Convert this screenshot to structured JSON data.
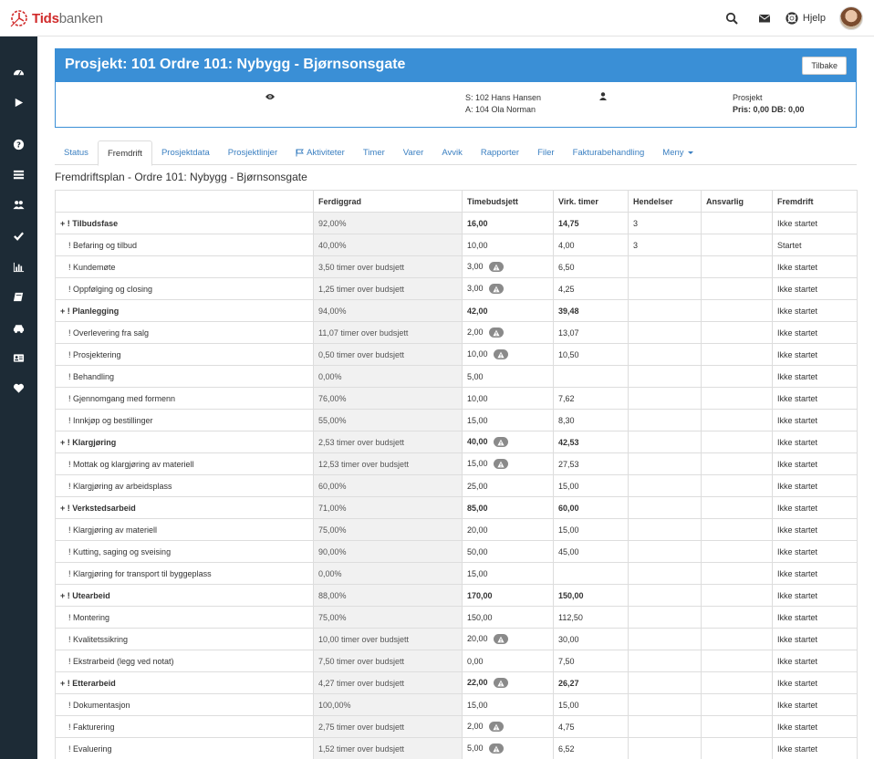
{
  "brand": {
    "part1": "Tids",
    "part2": "banken"
  },
  "topbar": {
    "help_label": "Hjelp"
  },
  "panel": {
    "title": "Prosjekt: 101 Ordre 101: Nybygg - Bjørnsonsgate",
    "back_label": "Tilbake",
    "line_s": "S: 102 Hans Hansen",
    "line_a": "A: 104 Ola Norman",
    "type_label": "Prosjekt",
    "price_label": "Pris: 0,00 DB: 0,00"
  },
  "tabs": [
    {
      "label": "Status"
    },
    {
      "label": "Fremdrift"
    },
    {
      "label": "Prosjektdata"
    },
    {
      "label": "Prosjektlinjer"
    },
    {
      "label": "Aktiviteter"
    },
    {
      "label": "Timer"
    },
    {
      "label": "Varer"
    },
    {
      "label": "Avvik"
    },
    {
      "label": "Rapporter"
    },
    {
      "label": "Filer"
    },
    {
      "label": "Fakturabehandling"
    },
    {
      "label": "Meny"
    }
  ],
  "section_title": "Fremdriftsplan - Ordre 101: Nybygg - Bjørnsonsgate",
  "table": {
    "headers": [
      "",
      "Ferdiggrad",
      "Timebudsjett",
      "Virk. timer",
      "Hendelser",
      "Ansvarlig",
      "Fremdrift"
    ],
    "rows": [
      {
        "main": true,
        "name": "+ ! Tilbudsfase",
        "fd": "92,00%",
        "tb": "16,00",
        "warn": false,
        "vt": "14,75",
        "he": "3",
        "an": "",
        "fr": "Ikke startet"
      },
      {
        "main": false,
        "name": "! Befaring og tilbud",
        "fd": "40,00%",
        "tb": "10,00",
        "warn": false,
        "vt": "4,00",
        "he": "3",
        "an": "",
        "fr": "Startet"
      },
      {
        "main": false,
        "name": "! Kundemøte",
        "fd": "3,50 timer over budsjett",
        "tb": "3,00",
        "warn": true,
        "vt": "6,50",
        "he": "",
        "an": "",
        "fr": "Ikke startet"
      },
      {
        "main": false,
        "name": "! Oppfølging og closing",
        "fd": "1,25 timer over budsjett",
        "tb": "3,00",
        "warn": true,
        "vt": "4,25",
        "he": "",
        "an": "",
        "fr": "Ikke startet"
      },
      {
        "main": true,
        "name": "+ ! Planlegging",
        "fd": "94,00%",
        "tb": "42,00",
        "warn": false,
        "vt": "39,48",
        "he": "",
        "an": "",
        "fr": "Ikke startet"
      },
      {
        "main": false,
        "name": "! Overlevering fra salg",
        "fd": "11,07 timer over budsjett",
        "tb": "2,00",
        "warn": true,
        "vt": "13,07",
        "he": "",
        "an": "",
        "fr": "Ikke startet"
      },
      {
        "main": false,
        "name": "! Prosjektering",
        "fd": "0,50 timer over budsjett",
        "tb": "10,00",
        "warn": true,
        "vt": "10,50",
        "he": "",
        "an": "",
        "fr": "Ikke startet"
      },
      {
        "main": false,
        "name": "! Behandling",
        "fd": "0,00%",
        "tb": "5,00",
        "warn": false,
        "vt": "",
        "he": "",
        "an": "",
        "fr": "Ikke startet"
      },
      {
        "main": false,
        "name": "! Gjennomgang med formenn",
        "fd": "76,00%",
        "tb": "10,00",
        "warn": false,
        "vt": "7,62",
        "he": "",
        "an": "",
        "fr": "Ikke startet"
      },
      {
        "main": false,
        "name": "! Innkjøp og bestillinger",
        "fd": "55,00%",
        "tb": "15,00",
        "warn": false,
        "vt": "8,30",
        "he": "",
        "an": "",
        "fr": "Ikke startet"
      },
      {
        "main": true,
        "name": "+ ! Klargjøring",
        "fd": "2,53 timer over budsjett",
        "tb": "40,00",
        "warn": true,
        "vt": "42,53",
        "he": "",
        "an": "",
        "fr": "Ikke startet"
      },
      {
        "main": false,
        "name": "! Mottak og klargjøring av materiell",
        "fd": "12,53 timer over budsjett",
        "tb": "15,00",
        "warn": true,
        "vt": "27,53",
        "he": "",
        "an": "",
        "fr": "Ikke startet"
      },
      {
        "main": false,
        "name": "! Klargjøring av arbeidsplass",
        "fd": "60,00%",
        "tb": "25,00",
        "warn": false,
        "vt": "15,00",
        "he": "",
        "an": "",
        "fr": "Ikke startet"
      },
      {
        "main": true,
        "name": "+ ! Verkstedsarbeid",
        "fd": "71,00%",
        "tb": "85,00",
        "warn": false,
        "vt": "60,00",
        "he": "",
        "an": "",
        "fr": "Ikke startet"
      },
      {
        "main": false,
        "name": "! Klargjøring av materiell",
        "fd": "75,00%",
        "tb": "20,00",
        "warn": false,
        "vt": "15,00",
        "he": "",
        "an": "",
        "fr": "Ikke startet"
      },
      {
        "main": false,
        "name": "! Kutting, saging og sveising",
        "fd": "90,00%",
        "tb": "50,00",
        "warn": false,
        "vt": "45,00",
        "he": "",
        "an": "",
        "fr": "Ikke startet"
      },
      {
        "main": false,
        "name": "! Klargjøring for transport til byggeplass",
        "fd": "0,00%",
        "tb": "15,00",
        "warn": false,
        "vt": "",
        "he": "",
        "an": "",
        "fr": "Ikke startet"
      },
      {
        "main": true,
        "name": "+ ! Utearbeid",
        "fd": "88,00%",
        "tb": "170,00",
        "warn": false,
        "vt": "150,00",
        "he": "",
        "an": "",
        "fr": "Ikke startet"
      },
      {
        "main": false,
        "name": "! Montering",
        "fd": "75,00%",
        "tb": "150,00",
        "warn": false,
        "vt": "112,50",
        "he": "",
        "an": "",
        "fr": "Ikke startet"
      },
      {
        "main": false,
        "name": "! Kvalitetssikring",
        "fd": "10,00 timer over budsjett",
        "tb": "20,00",
        "warn": true,
        "vt": "30,00",
        "he": "",
        "an": "",
        "fr": "Ikke startet"
      },
      {
        "main": false,
        "name": "! Ekstrarbeid (legg ved notat)",
        "fd": "7,50 timer over budsjett",
        "tb": "0,00",
        "warn": false,
        "vt": "7,50",
        "he": "",
        "an": "",
        "fr": "Ikke startet"
      },
      {
        "main": true,
        "name": "+ ! Etterarbeid",
        "fd": "4,27 timer over budsjett",
        "tb": "22,00",
        "warn": true,
        "vt": "26,27",
        "he": "",
        "an": "",
        "fr": "Ikke startet"
      },
      {
        "main": false,
        "name": "! Dokumentasjon",
        "fd": "100,00%",
        "tb": "15,00",
        "warn": false,
        "vt": "15,00",
        "he": "",
        "an": "",
        "fr": "Ikke startet"
      },
      {
        "main": false,
        "name": "! Fakturering",
        "fd": "2,75 timer over budsjett",
        "tb": "2,00",
        "warn": true,
        "vt": "4,75",
        "he": "",
        "an": "",
        "fr": "Ikke startet"
      },
      {
        "main": false,
        "name": "! Evaluering",
        "fd": "1,52 timer over budsjett",
        "tb": "5,00",
        "warn": true,
        "vt": "6,52",
        "he": "",
        "an": "",
        "fr": "Ikke startet"
      }
    ]
  },
  "colors": {
    "accent": "#3a8fd6",
    "sidebar": "#1d2b36",
    "brand_red": "#d02a2a"
  },
  "icons": {
    "sidebar": [
      "dashboard-icon",
      "play-icon",
      "question-icon",
      "list-icon",
      "users-icon",
      "check-icon",
      "bar-chart-icon",
      "book-icon",
      "car-icon",
      "id-card-icon",
      "heart-icon"
    ],
    "topbar": [
      "search-icon",
      "envelope-icon",
      "lifebuoy-icon"
    ]
  }
}
